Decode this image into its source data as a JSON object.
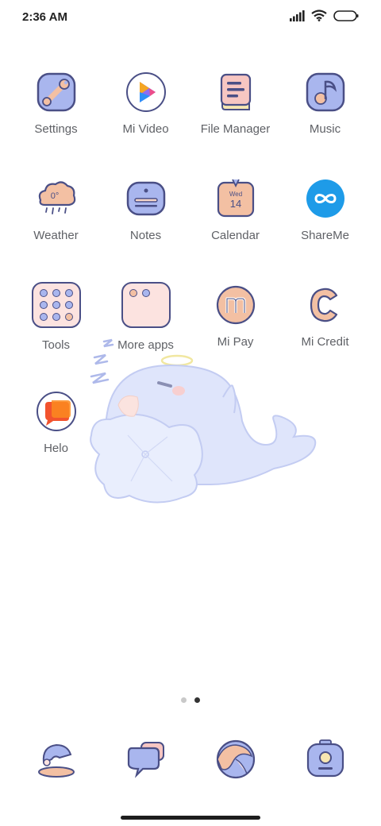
{
  "status_bar": {
    "time": "2:36 AM",
    "icons": [
      "signal-icon",
      "wifi-icon",
      "battery-icon"
    ]
  },
  "apps": [
    {
      "label": "Settings",
      "icon": "settings-icon"
    },
    {
      "label": "Mi Video",
      "icon": "mi-video-icon"
    },
    {
      "label": "File Manager",
      "icon": "file-manager-icon"
    },
    {
      "label": "Music",
      "icon": "music-icon"
    },
    {
      "label": "Weather",
      "icon": "weather-icon",
      "icon_text": "0°"
    },
    {
      "label": "Notes",
      "icon": "notes-icon"
    },
    {
      "label": "Calendar",
      "icon": "calendar-icon",
      "icon_day": "Wed",
      "icon_date": "14"
    },
    {
      "label": "ShareMe",
      "icon": "shareme-icon"
    },
    {
      "label": "Tools",
      "icon": "tools-folder-icon"
    },
    {
      "label": "More apps",
      "icon": "more-apps-folder-icon"
    },
    {
      "label": "Mi Pay",
      "icon": "mi-pay-icon"
    },
    {
      "label": "Mi Credit",
      "icon": "mi-credit-icon"
    },
    {
      "label": "Helo",
      "icon": "helo-icon"
    }
  ],
  "page_indicator": {
    "pages": 2,
    "current": 2
  },
  "dock": [
    {
      "icon": "phone-icon"
    },
    {
      "icon": "messages-icon"
    },
    {
      "icon": "browser-icon"
    },
    {
      "icon": "camera-icon"
    }
  ],
  "colors": {
    "outline": "#4a4f86",
    "lavender": "#a9b6ee",
    "peach": "#f3c0a3",
    "pink": "#fce3e0",
    "shareme_blue": "#1e9be8"
  }
}
